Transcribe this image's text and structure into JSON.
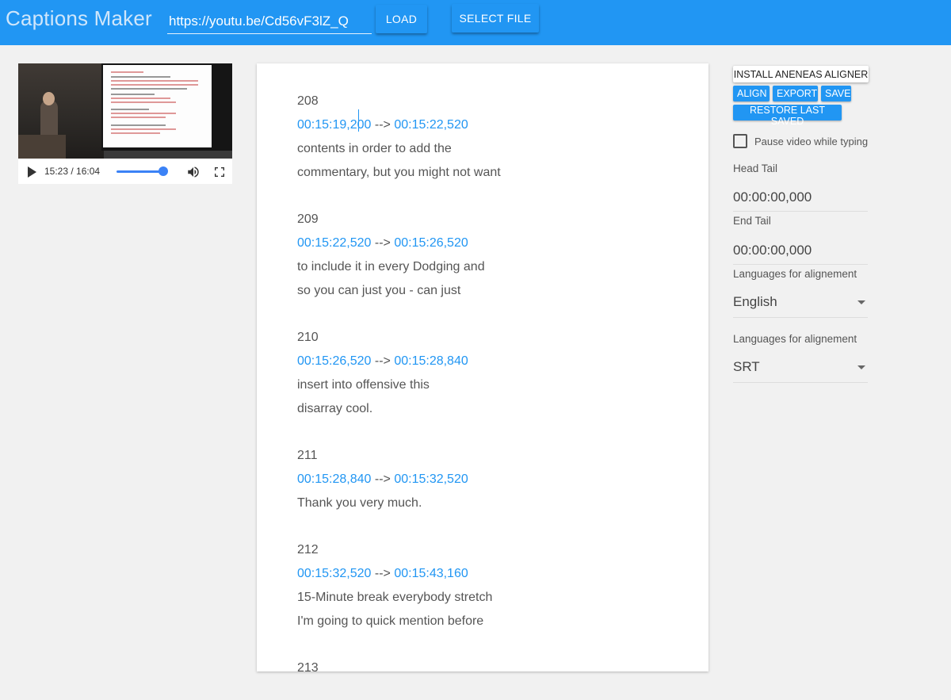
{
  "header": {
    "title": "Captions Maker",
    "url_value": "https://youtu.be/Cd56vF3lZ_Q",
    "load_label": "LOAD",
    "select_file_label": "SELECT FILE"
  },
  "video": {
    "time_display": "15:23 / 16:04",
    "progress": 0.957
  },
  "captions": [
    {
      "number": "208",
      "start": "00:15:19,200",
      "arrow": "-->",
      "end": "00:15:22,520",
      "lines": [
        "contents in order to add the",
        "commentary, but you might not want"
      ]
    },
    {
      "number": "209",
      "start": "00:15:22,520",
      "arrow": "-->",
      "end": "00:15:26,520",
      "lines": [
        "to include it in every Dodging and",
        "so you can just you - can just"
      ]
    },
    {
      "number": "210",
      "start": "00:15:26,520",
      "arrow": "-->",
      "end": "00:15:28,840",
      "lines": [
        "insert into offensive this",
        "disarray cool."
      ]
    },
    {
      "number": "211",
      "start": "00:15:28,840",
      "arrow": "-->",
      "end": "00:15:32,520",
      "lines": [
        "Thank you very much."
      ]
    },
    {
      "number": "212",
      "start": "00:15:32,520",
      "arrow": "-->",
      "end": "00:15:43,160",
      "lines": [
        "15-Minute break everybody stretch",
        "I'm going to quick mention before"
      ]
    },
    {
      "number": "213",
      "start": "",
      "arrow": "",
      "end": "",
      "lines": []
    }
  ],
  "panel": {
    "install_label": "INSTALL ANENEAS ALIGNER",
    "align_label": "ALIGN",
    "export_label": "EXPORT",
    "save_label": "SAVE",
    "restore_label": "RESTORE LAST SAVED",
    "pause_label": "Pause video while typing",
    "pause_checked": false,
    "head_tail_label": "Head Tail",
    "head_tail_value": "00:00:00,000",
    "end_tail_label": "End Tail",
    "end_tail_value": "00:00:00,000",
    "language_label": "Languages for alignement",
    "language_value": "English",
    "format_label": "Languages for alignement",
    "format_value": "SRT"
  },
  "colors": {
    "primary": "#2196f3",
    "timestamp": "#2196f3",
    "background": "#f1f1f1"
  }
}
